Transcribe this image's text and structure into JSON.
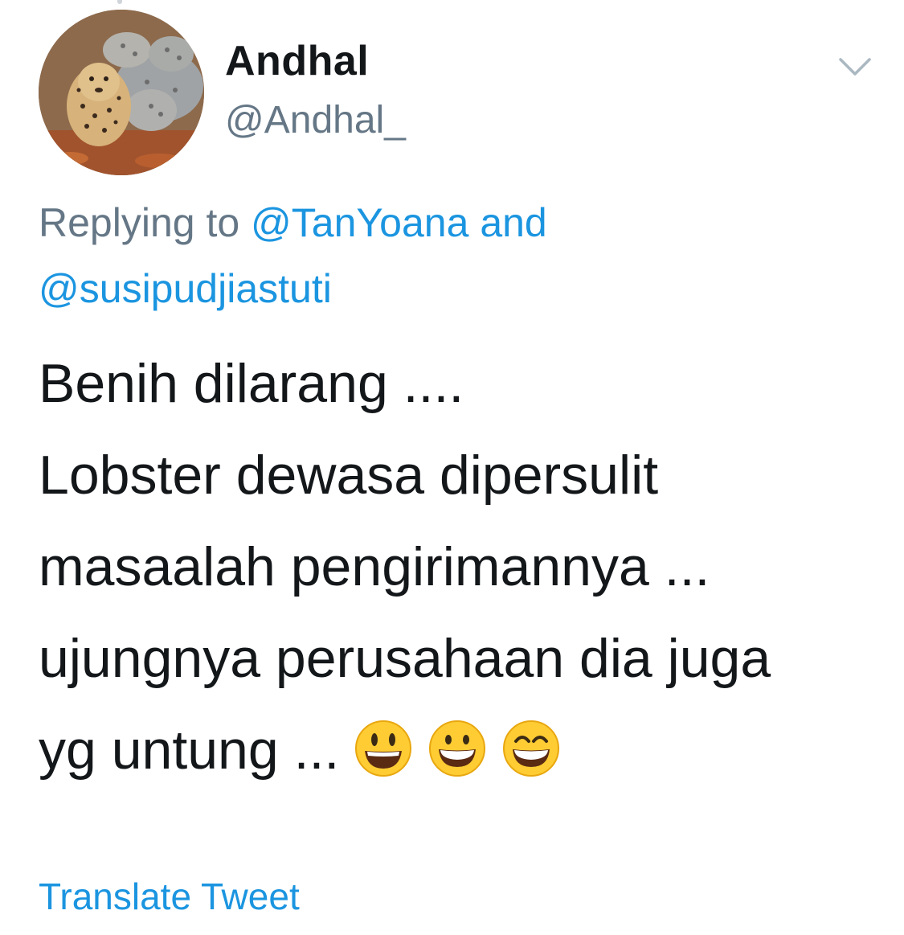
{
  "author": {
    "display_name": "Andhal",
    "handle": "@Andhal_"
  },
  "reply": {
    "prefix": "Replying to ",
    "mention_1": "@TanYoana",
    "connector": " and",
    "mention_2": "@susipudjiastuti"
  },
  "tweet": {
    "lines": [
      "Benih dilarang ....",
      "Lobster dewasa dipersulit",
      "masaalah pengirimannya ...",
      "ujungnya perusahaan dia juga",
      "yg untung ..."
    ],
    "emojis": [
      "smiling-face-open-mouth-icon",
      "grinning-face-icon",
      "grinning-face-smiling-eyes-icon"
    ]
  },
  "translate_label": "Translate Tweet",
  "colors": {
    "text": "#14171a",
    "secondary": "#657786",
    "link": "#1b95e0",
    "emoji_face": "#ffcc33"
  }
}
